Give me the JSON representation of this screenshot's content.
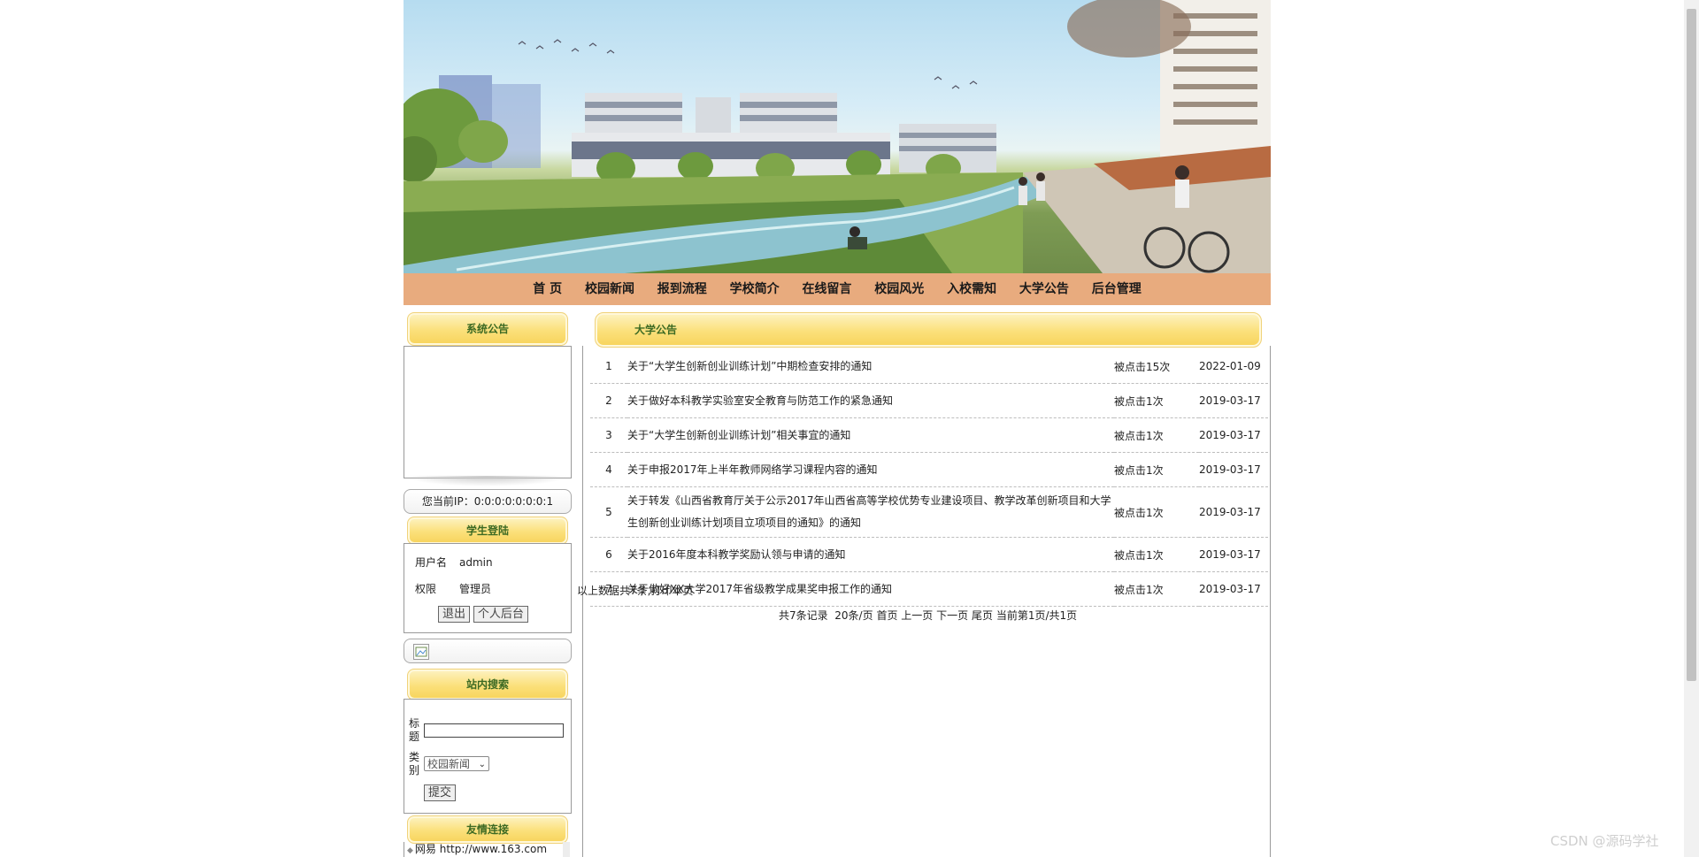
{
  "nav": {
    "items": [
      "首 页",
      "校园新闻",
      "报到流程",
      "学校简介",
      "在线留言",
      "校园风光",
      "入校需知",
      "大学公告",
      "后台管理"
    ]
  },
  "sidebar": {
    "notice_title": "系统公告",
    "ip_text": "您当前IP：0:0:0:0:0:0:0:1",
    "login_title": "学生登陆",
    "username_label": "用户名",
    "username_value": "admin",
    "role_label": "权限",
    "role_value": "管理员",
    "logout_button": "退出",
    "personal_button": "个人后台",
    "search_title": "站内搜索",
    "search_title_label": "标题",
    "search_category_label": "类别",
    "search_category_value": "校园新闻",
    "submit_button": "提交",
    "links_title": "友情连接",
    "links": [
      "网易 http://www.163.com"
    ]
  },
  "announcements": {
    "title": "大学公告",
    "rows": [
      {
        "no": "1",
        "title": "关于“大学生创新创业训练计划”中期检查安排的通知",
        "hits": "被点击15次",
        "date": "2022-01-09"
      },
      {
        "no": "2",
        "title": "关于做好本科教学实验室安全教育与防范工作的紧急通知",
        "hits": "被点击1次",
        "date": "2019-03-17"
      },
      {
        "no": "3",
        "title": "关于“大学生创新创业训练计划”相关事宜的通知",
        "hits": "被点击1次",
        "date": "2019-03-17"
      },
      {
        "no": "4",
        "title": "关于申报2017年上半年教师网络学习课程内容的通知",
        "hits": "被点击1次",
        "date": "2019-03-17"
      },
      {
        "no": "5",
        "title": "关于转发《山西省教育厅关于公示2017年山西省高等学校优势专业建设项目、教学改革创新项目和大学生创新创业训练计划项目立项项目的通知》的通知",
        "hits": "被点击1次",
        "date": "2019-03-17"
      },
      {
        "no": "6",
        "title": "关于2016年度本科教学奖励认领与申请的通知",
        "hits": "被点击1次",
        "date": "2019-03-17"
      },
      {
        "no": "7",
        "title": "关于做好XX大学2017年省级教学成果奖申报工作的通知",
        "hits": "被点击1次",
        "date": "2019-03-17"
      }
    ],
    "summary": "以上数据共7条,打印本页",
    "pager": {
      "total": "共7条记录",
      "per_page": "20条/页",
      "first": "首页",
      "prev": "上一页",
      "next": "下一页",
      "last": "尾页",
      "current": "当前第1页/共1页"
    }
  },
  "watermark": "CSDN @源码学社"
}
